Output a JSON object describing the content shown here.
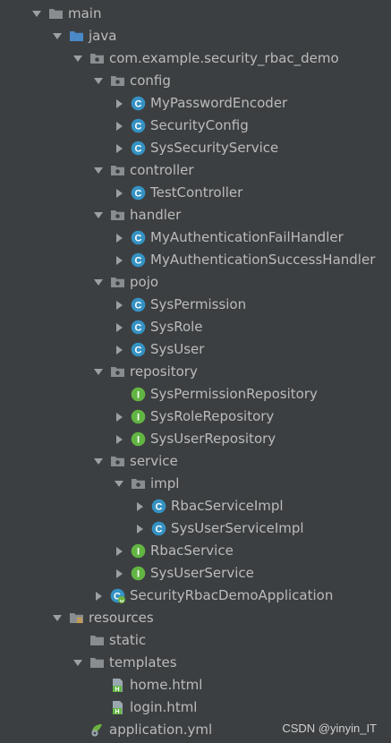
{
  "tree": [
    {
      "label": "main",
      "level": 0,
      "expand": "down",
      "icon": "folder-gray-icon"
    },
    {
      "label": "java",
      "level": 1,
      "expand": "down",
      "icon": "source-folder-icon"
    },
    {
      "label": "com.example.security_rbac_demo",
      "level": 2,
      "expand": "down",
      "icon": "package-icon"
    },
    {
      "label": "config",
      "level": 3,
      "expand": "down",
      "icon": "package-icon"
    },
    {
      "label": "MyPasswordEncoder",
      "level": 4,
      "expand": "right",
      "icon": "class-icon"
    },
    {
      "label": "SecurityConfig",
      "level": 4,
      "expand": "right",
      "icon": "class-icon"
    },
    {
      "label": "SysSecurityService",
      "level": 4,
      "expand": "right",
      "icon": "class-icon"
    },
    {
      "label": "controller",
      "level": 3,
      "expand": "down",
      "icon": "package-icon"
    },
    {
      "label": "TestController",
      "level": 4,
      "expand": "right",
      "icon": "class-icon"
    },
    {
      "label": "handler",
      "level": 3,
      "expand": "down",
      "icon": "package-icon"
    },
    {
      "label": "MyAuthenticationFailHandler",
      "level": 4,
      "expand": "right",
      "icon": "class-icon"
    },
    {
      "label": "MyAuthenticationSuccessHandler",
      "level": 4,
      "expand": "right",
      "icon": "class-icon"
    },
    {
      "label": "pojo",
      "level": 3,
      "expand": "down",
      "icon": "package-icon"
    },
    {
      "label": "SysPermission",
      "level": 4,
      "expand": "right",
      "icon": "class-icon"
    },
    {
      "label": "SysRole",
      "level": 4,
      "expand": "right",
      "icon": "class-icon"
    },
    {
      "label": "SysUser",
      "level": 4,
      "expand": "right",
      "icon": "class-icon"
    },
    {
      "label": "repository",
      "level": 3,
      "expand": "down",
      "icon": "package-icon"
    },
    {
      "label": "SysPermissionRepository",
      "level": 4,
      "expand": "none",
      "icon": "interface-icon"
    },
    {
      "label": "SysRoleRepository",
      "level": 4,
      "expand": "right",
      "icon": "interface-icon"
    },
    {
      "label": "SysUserRepository",
      "level": 4,
      "expand": "right",
      "icon": "interface-icon"
    },
    {
      "label": "service",
      "level": 3,
      "expand": "down",
      "icon": "package-icon"
    },
    {
      "label": "impl",
      "level": 4,
      "expand": "down",
      "icon": "package-icon"
    },
    {
      "label": "RbacServiceImpl",
      "level": 5,
      "expand": "right",
      "icon": "class-icon"
    },
    {
      "label": "SysUserServiceImpl",
      "level": 5,
      "expand": "right",
      "icon": "class-icon"
    },
    {
      "label": "RbacService",
      "level": 4,
      "expand": "right",
      "icon": "interface-icon"
    },
    {
      "label": "SysUserService",
      "level": 4,
      "expand": "right",
      "icon": "interface-icon"
    },
    {
      "label": "SecurityRbacDemoApplication",
      "level": 3,
      "expand": "right",
      "icon": "spring-boot-class-icon"
    },
    {
      "label": "resources",
      "level": 1,
      "expand": "down",
      "icon": "resources-folder-icon"
    },
    {
      "label": "static",
      "level": 2,
      "expand": "none",
      "icon": "folder-gray-icon"
    },
    {
      "label": "templates",
      "level": 2,
      "expand": "down",
      "icon": "folder-gray-icon"
    },
    {
      "label": "home.html",
      "level": 3,
      "expand": "none",
      "icon": "html-file-icon"
    },
    {
      "label": "login.html",
      "level": 3,
      "expand": "none",
      "icon": "html-file-icon"
    },
    {
      "label": "application.yml",
      "level": 2,
      "expand": "none",
      "icon": "spring-yml-icon"
    }
  ],
  "watermark": "CSDN @yinyin_IT",
  "colors": {
    "background": "#3c3f41",
    "text": "#bbbbbb",
    "arrow": "#9da0a2",
    "folder": "#8a8d8f",
    "source_folder": "#4a88c7",
    "class_badge": "#3592c4",
    "interface_badge": "#62b543",
    "html_badge": "#62b543",
    "spring": "#6db33f"
  }
}
